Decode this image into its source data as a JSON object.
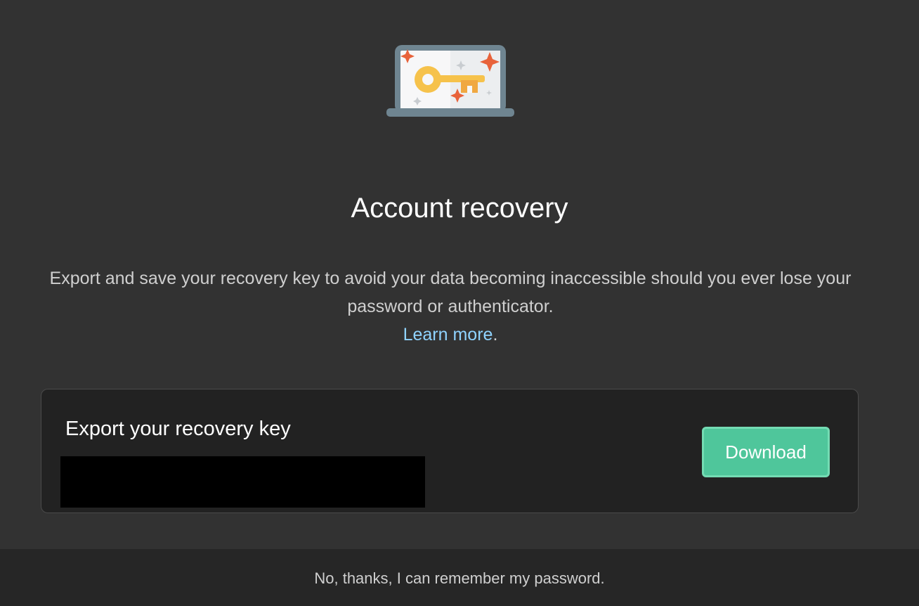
{
  "illustration": {
    "icon": "laptop-key-icon",
    "colors": {
      "laptop_frame": "#6f8591",
      "screen": "#f7f7f8",
      "key": "#f6c24b",
      "sparkle_orange": "#e8623a",
      "sparkle_gray": "#c8ccd0"
    }
  },
  "title": "Account recovery",
  "description": {
    "text": "Export and save your recovery key to avoid your data becoming inaccessible should you ever lose your password or authenticator.",
    "learn_more": "Learn more",
    "period": "."
  },
  "card": {
    "title": "Export your recovery key",
    "download_label": "Download",
    "accent": "#4fc69b"
  },
  "footer": {
    "dismiss_label": "No, thanks, I can remember my password."
  }
}
